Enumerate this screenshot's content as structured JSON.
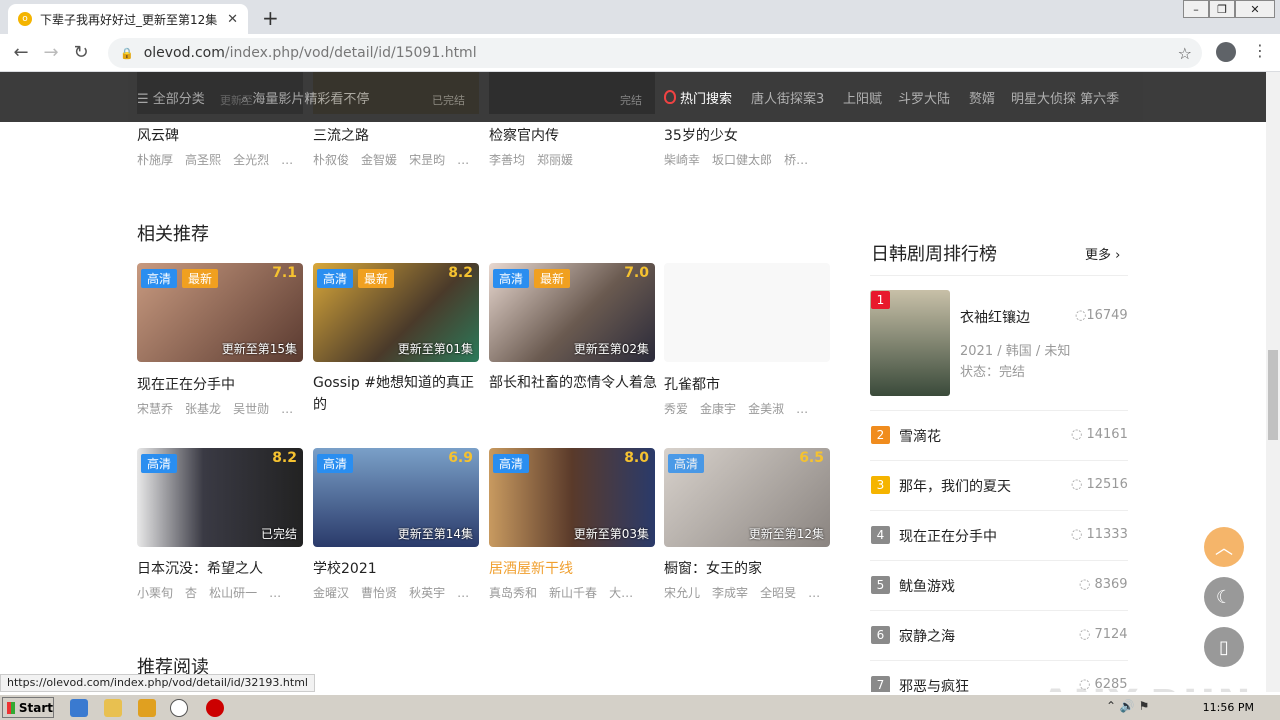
{
  "browser": {
    "tab_title": "下辈子我再好好过_更新至第12集 - ",
    "tab_favicon_letter": "o",
    "url_domain": "olevod.com",
    "url_path": "/index.php/vod/detail/id/15091.html",
    "status_url": "https://olevod.com/index.php/vod/detail/id/32193.html"
  },
  "topbar": {
    "category": "全部分类",
    "search_placeholder": "海量影片精彩看不停",
    "hot_label": "热门搜索",
    "hot_terms": [
      "唐人街探案3",
      "上阳赋",
      "斗罗大陆",
      "赘婿",
      "明星大侦探 第六季"
    ],
    "ghost_labels": [
      "更新至",
      "已完结",
      "完结"
    ]
  },
  "top_row": [
    {
      "title": "风云碑",
      "cast": [
        "朴施厚",
        "高圣熙",
        "全光烈",
        "…"
      ]
    },
    {
      "title": "三流之路",
      "cast": [
        "朴叙俊",
        "金智媛",
        "宋昰昀",
        "…"
      ]
    },
    {
      "title": "检察官内传",
      "cast": [
        "李善均",
        "郑丽媛"
      ]
    },
    {
      "title": "35岁的少女",
      "cast": [
        "柴崎幸",
        "坂口健太郎",
        "桥…"
      ]
    }
  ],
  "related": {
    "heading": "相关推荐",
    "items": [
      {
        "title": "现在正在分手中",
        "score": "7.1",
        "update": "更新至第15集",
        "badges": [
          "高清",
          "最新"
        ],
        "cast": [
          "宋慧乔",
          "张基龙",
          "吴世勋",
          "…"
        ],
        "color": "#a06a54"
      },
      {
        "title": "Gossip #她想知道的真正的",
        "score": "8.2",
        "update": "更新至第01集",
        "badges": [
          "高清",
          "最新"
        ],
        "cast": [],
        "color": "#8a6a2a"
      },
      {
        "title": "部长和社畜的恋情令人着急",
        "score": "7.0",
        "update": "更新至第02集",
        "badges": [
          "高清",
          "最新"
        ],
        "cast": [],
        "color": "#c9b7ad"
      },
      {
        "title": "孔雀都市",
        "score": "",
        "update": "",
        "badges": [],
        "cast": [
          "秀爱",
          "金康宇",
          "金美淑",
          "…"
        ],
        "color": "#f8f8f8"
      }
    ]
  },
  "second_row": [
    {
      "title": "日本沉没：希望之人",
      "score": "8.2",
      "update": "已完结",
      "badges": [
        "高清"
      ],
      "cast": [
        "小栗旬",
        "杏",
        "松山研一",
        "…"
      ],
      "color": "#3a3a44",
      "highlight": false
    },
    {
      "title": "学校2021",
      "score": "6.9",
      "update": "更新至第14集",
      "badges": [
        "高清"
      ],
      "cast": [
        "金曜汉",
        "曹怡贤",
        "秋英宇",
        "…"
      ],
      "color": "#3b5a8a",
      "highlight": false
    },
    {
      "title": "居酒屋新干线",
      "score": "8.0",
      "update": "更新至第03集",
      "badges": [
        "高清"
      ],
      "cast": [
        "真岛秀和",
        "新山千春",
        "大…"
      ],
      "color": "#5a3a2a",
      "highlight": true
    },
    {
      "title": "橱窗：女王的家",
      "score": "6.5",
      "update": "更新至第12集",
      "badges": [
        "高清"
      ],
      "cast": [
        "宋允儿",
        "李成宰",
        "全昭旻",
        "…"
      ],
      "color": "#b8b2ac",
      "highlight": false
    }
  ],
  "reading_heading": "推荐阅读",
  "ranking": {
    "heading": "日韩剧周排行榜",
    "more": "更多",
    "top": {
      "rank": "1",
      "title": "衣袖红镶边",
      "count": "16749",
      "meta": "2021 / 韩国 / 未知",
      "status": "状态：完结"
    },
    "items": [
      {
        "rank": "2",
        "title": "雪滴花",
        "count": "14161",
        "color": "#f08c1e"
      },
      {
        "rank": "3",
        "title": "那年，我们的夏天",
        "count": "12516",
        "color": "#f5b400"
      },
      {
        "rank": "4",
        "title": "现在正在分手中",
        "count": "11333",
        "color": "#8a8a8a"
      },
      {
        "rank": "5",
        "title": "鱿鱼游戏",
        "count": "8369",
        "color": "#8a8a8a"
      },
      {
        "rank": "6",
        "title": "寂静之海",
        "count": "7124",
        "color": "#8a8a8a"
      },
      {
        "rank": "7",
        "title": "邪恶与疯狂",
        "count": "6285",
        "color": "#8a8a8a"
      }
    ]
  },
  "taskbar": {
    "start": "Start",
    "clock": "11:56 PM"
  },
  "watermark": "ANY.RUN"
}
